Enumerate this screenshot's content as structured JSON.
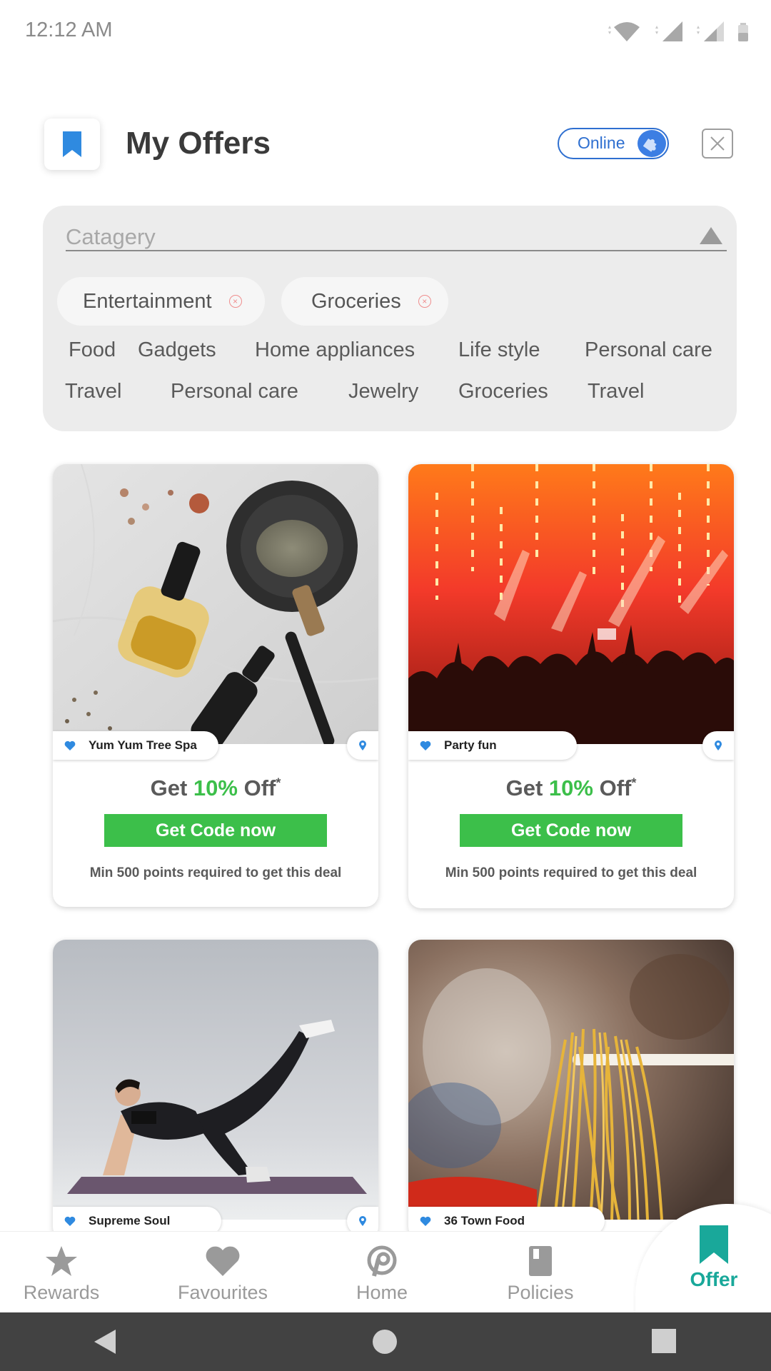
{
  "status_bar": {
    "time": "12:12 AM"
  },
  "header": {
    "title": "My Offers",
    "online_label": "Online"
  },
  "category": {
    "placeholder": "Catagery",
    "selected_chips": [
      "Entertainment",
      "Groceries"
    ],
    "items_row1": [
      "Food",
      "Gadgets",
      "Home appliances",
      "Life style",
      "Personal care"
    ],
    "items_row2": [
      "Travel",
      "Personal care",
      "Jewelry",
      "Groceries",
      "Travel"
    ]
  },
  "offers": [
    {
      "name": "Yum Yum Tree Spa",
      "offer_prefix": "Get ",
      "offer_pct": "10%",
      "offer_suffix": " Off",
      "asterisk": "*",
      "cta": "Get Code now",
      "min_points": "Min 500 points required to get this deal"
    },
    {
      "name": "Party fun",
      "offer_prefix": "Get ",
      "offer_pct": "10%",
      "offer_suffix": " Off",
      "asterisk": "*",
      "cta": "Get Code now",
      "min_points": "Min 500 points required to get this deal"
    },
    {
      "name": "Supreme Soul"
    },
    {
      "name": "36 Town Food"
    }
  ],
  "bottom_nav": {
    "items": [
      "Rewards",
      "Favourites",
      "Home",
      "Policies",
      "Offer"
    ],
    "active": "Offer"
  },
  "colors": {
    "accent_green": "#3cbf4a",
    "accent_teal": "#19a89a",
    "accent_blue": "#2e6fd0",
    "heart_blue": "#2f8ae0"
  }
}
